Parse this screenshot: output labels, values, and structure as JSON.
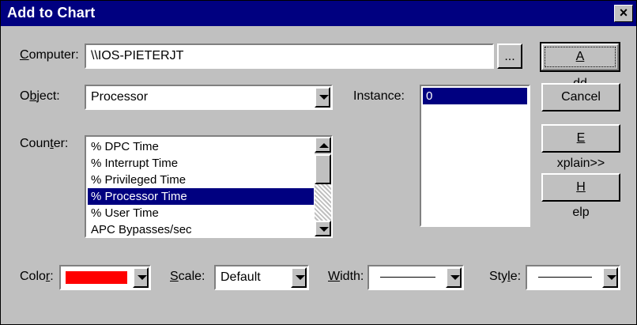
{
  "window": {
    "title": "Add to Chart",
    "close_symbol": "×"
  },
  "computer": {
    "label_pre": "",
    "label_ul": "C",
    "label_post": "omputer:",
    "value": "\\\\IOS-PIETERJT",
    "browse_label": "..."
  },
  "object": {
    "label_pre": "O",
    "label_ul": "b",
    "label_post": "ject:",
    "value": "Processor"
  },
  "instance": {
    "label": "Instance:",
    "items": [
      "0"
    ],
    "selected_index": 0
  },
  "counter": {
    "label_pre": "Coun",
    "label_ul": "t",
    "label_post": "er:",
    "items": [
      "% DPC Time",
      "% Interrupt Time",
      "% Privileged Time",
      "% Processor Time",
      "% User Time",
      "APC Bypasses/sec"
    ],
    "selected_index": 3
  },
  "buttons": {
    "add": {
      "pre": "",
      "ul": "A",
      "post": "dd"
    },
    "cancel": {
      "label": "Cancel"
    },
    "explain": {
      "pre": "",
      "ul": "E",
      "post": "xplain>>"
    },
    "help": {
      "pre": "",
      "ul": "H",
      "post": "elp"
    }
  },
  "color": {
    "label_pre": "Colo",
    "label_ul": "r",
    "label_post": ":",
    "value_hex": "#ff0000"
  },
  "scale": {
    "label_pre": "",
    "label_ul": "S",
    "label_post": "cale:",
    "value": "Default"
  },
  "width": {
    "label_pre": "",
    "label_ul": "W",
    "label_post": "idth:",
    "value": "solid-line"
  },
  "style": {
    "label_pre": "Sty",
    "label_ul": "l",
    "label_post": "e:",
    "value": "solid-line"
  },
  "colors": {
    "title_bar": "#000080",
    "selection": "#000080",
    "face": "#c0c0c0"
  }
}
